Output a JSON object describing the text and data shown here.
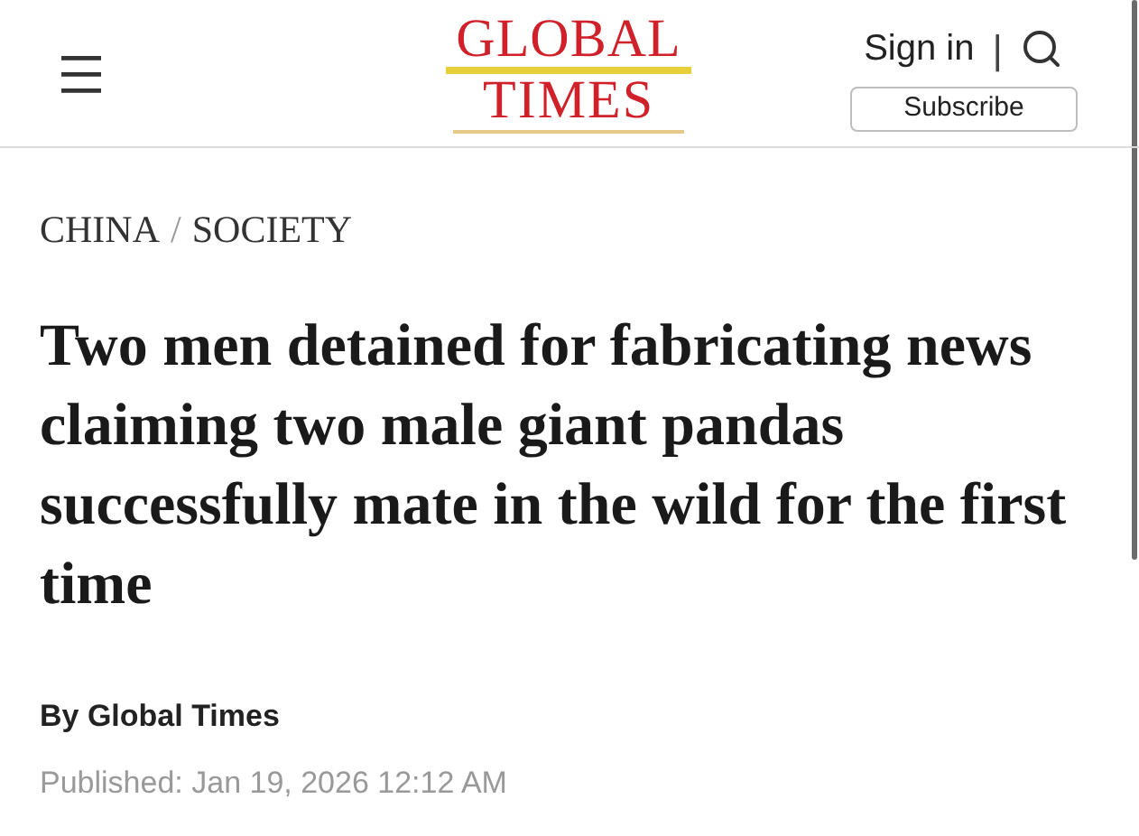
{
  "header": {
    "logo": {
      "line_1": "GLOBAL",
      "line_2": "TIMES"
    },
    "sign_in": "Sign in",
    "separator": "|",
    "subscribe": "Subscribe"
  },
  "breadcrumb": [
    {
      "label": "CHINA"
    },
    {
      "label": "SOCIETY"
    }
  ],
  "breadcrumb_separator": "/",
  "article": {
    "headline": "Two men detained for fabricating news claiming two male giant pandas successfully mate in the wild for the first time",
    "byline": "By Global Times",
    "published": "Published: Jan 19, 2026 12:12 AM"
  }
}
